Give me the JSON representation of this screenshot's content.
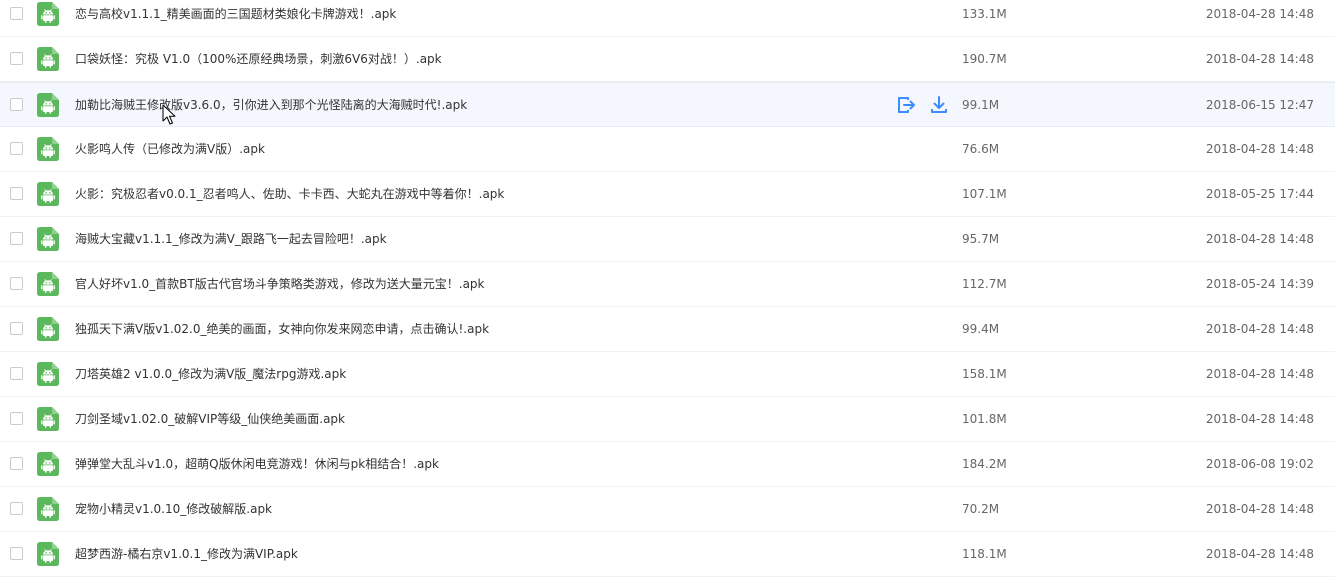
{
  "file_list": {
    "rows": [
      {
        "name": "恋与高校v1.1.1_精美画面的三国题材类娘化卡牌游戏！.apk",
        "size": "133.1M",
        "date": "2018-04-28 14:48"
      },
      {
        "name": "口袋妖怪：究极 V1.0（100%还原经典场景，刺激6V6对战！）.apk",
        "size": "190.7M",
        "date": "2018-04-28 14:48"
      },
      {
        "name": "加勒比海贼王修改版v3.6.0，引你进入到那个光怪陆离的大海贼时代!.apk",
        "size": "99.1M",
        "date": "2018-06-15 12:47"
      },
      {
        "name": "火影鸣人传（已修改为满V版）.apk",
        "size": "76.6M",
        "date": "2018-04-28 14:48"
      },
      {
        "name": "火影：究极忍者v0.0.1_忍者鸣人、佐助、卡卡西、大蛇丸在游戏中等着你！.apk",
        "size": "107.1M",
        "date": "2018-05-25 17:44"
      },
      {
        "name": "海贼大宝藏v1.1.1_修改为满V_跟路飞一起去冒险吧！.apk",
        "size": "95.7M",
        "date": "2018-04-28 14:48"
      },
      {
        "name": "官人好坏v1.0_首款BT版古代官场斗争策略类游戏，修改为送大量元宝！.apk",
        "size": "112.7M",
        "date": "2018-05-24 14:39"
      },
      {
        "name": "独孤天下满V版v1.02.0_绝美的画面，女神向你发来网恋申请，点击确认!.apk",
        "size": "99.4M",
        "date": "2018-04-28 14:48"
      },
      {
        "name": "刀塔英雄2 v1.0.0_修改为满V版_魔法rpg游戏.apk",
        "size": "158.1M",
        "date": "2018-04-28 14:48"
      },
      {
        "name": "刀剑圣域v1.02.0_破解VIP等级_仙侠绝美画面.apk",
        "size": "101.8M",
        "date": "2018-04-28 14:48"
      },
      {
        "name": "弹弹堂大乱斗v1.0，超萌Q版休闲电竞游戏！休闲与pk相结合！.apk",
        "size": "184.2M",
        "date": "2018-06-08 19:02"
      },
      {
        "name": "宠物小精灵v1.0.10_修改破解版.apk",
        "size": "70.2M",
        "date": "2018-04-28 14:48"
      },
      {
        "name": "超梦西游-橘右京v1.0.1_修改为满VIP.apk",
        "size": "118.1M",
        "date": "2018-04-28 14:48"
      }
    ],
    "hovered_row_index": 2,
    "row_actions": [
      "share-icon",
      "download-icon"
    ],
    "file_icon": "android-apk-icon"
  },
  "colors": {
    "icon_green": "#5cb85c",
    "action_blue": "#3b8cff",
    "hover_bg": "#f4f8fe",
    "text": "#333333",
    "meta_text": "#666666"
  }
}
